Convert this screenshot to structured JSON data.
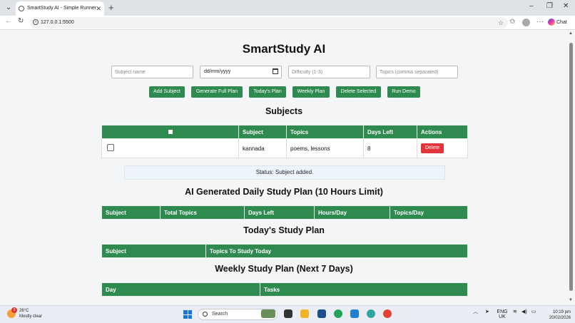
{
  "browser": {
    "tab_title": "SmartStudy AI - Simple Runner",
    "url": "127.0.0.1:5500",
    "chat_label": "Chat"
  },
  "app": {
    "title": "SmartStudy AI",
    "inputs": {
      "subject_placeholder": "Subject name",
      "date_placeholder": "dd/mm/yyyy",
      "difficulty_placeholder": "Difficulty (1-3)",
      "topics_placeholder": "Topics (comma separated)"
    },
    "buttons": {
      "add_subject": "Add Subject",
      "generate_full_plan": "Generate Full Plan",
      "todays_plan": "Today's Plan",
      "weekly_plan": "Weekly Plan",
      "delete_selected": "Delete Selected",
      "run_demo": "Run Demo"
    },
    "subjects": {
      "heading": "Subjects",
      "columns": [
        "",
        "Subject",
        "Topics",
        "Days Left",
        "Actions"
      ],
      "rows": [
        {
          "subject": "kannada",
          "topics": "poems, lessons",
          "days_left": "8",
          "action": "Delete"
        }
      ]
    },
    "status": "Status: Subject added.",
    "daily_plan": {
      "heading": "AI Generated Daily Study Plan (10 Hours Limit)",
      "columns": [
        "Subject",
        "Total Topics",
        "Days Left",
        "Hours/Day",
        "Topics/Day"
      ]
    },
    "todays_plan": {
      "heading": "Today's Study Plan",
      "columns": [
        "Subject",
        "Topics To Study Today"
      ]
    },
    "weekly_plan": {
      "heading": "Weekly Study Plan (Next 7 Days)",
      "columns": [
        "Day",
        "Tasks"
      ]
    }
  },
  "taskbar": {
    "weather_temp": "26°C",
    "weather_desc": "Mostly clear",
    "weather_badge": "3",
    "search_label": "Search",
    "lang_line1": "ENG",
    "lang_line2": "UK",
    "time": "10:19 pm",
    "date": "20/02/2026"
  }
}
